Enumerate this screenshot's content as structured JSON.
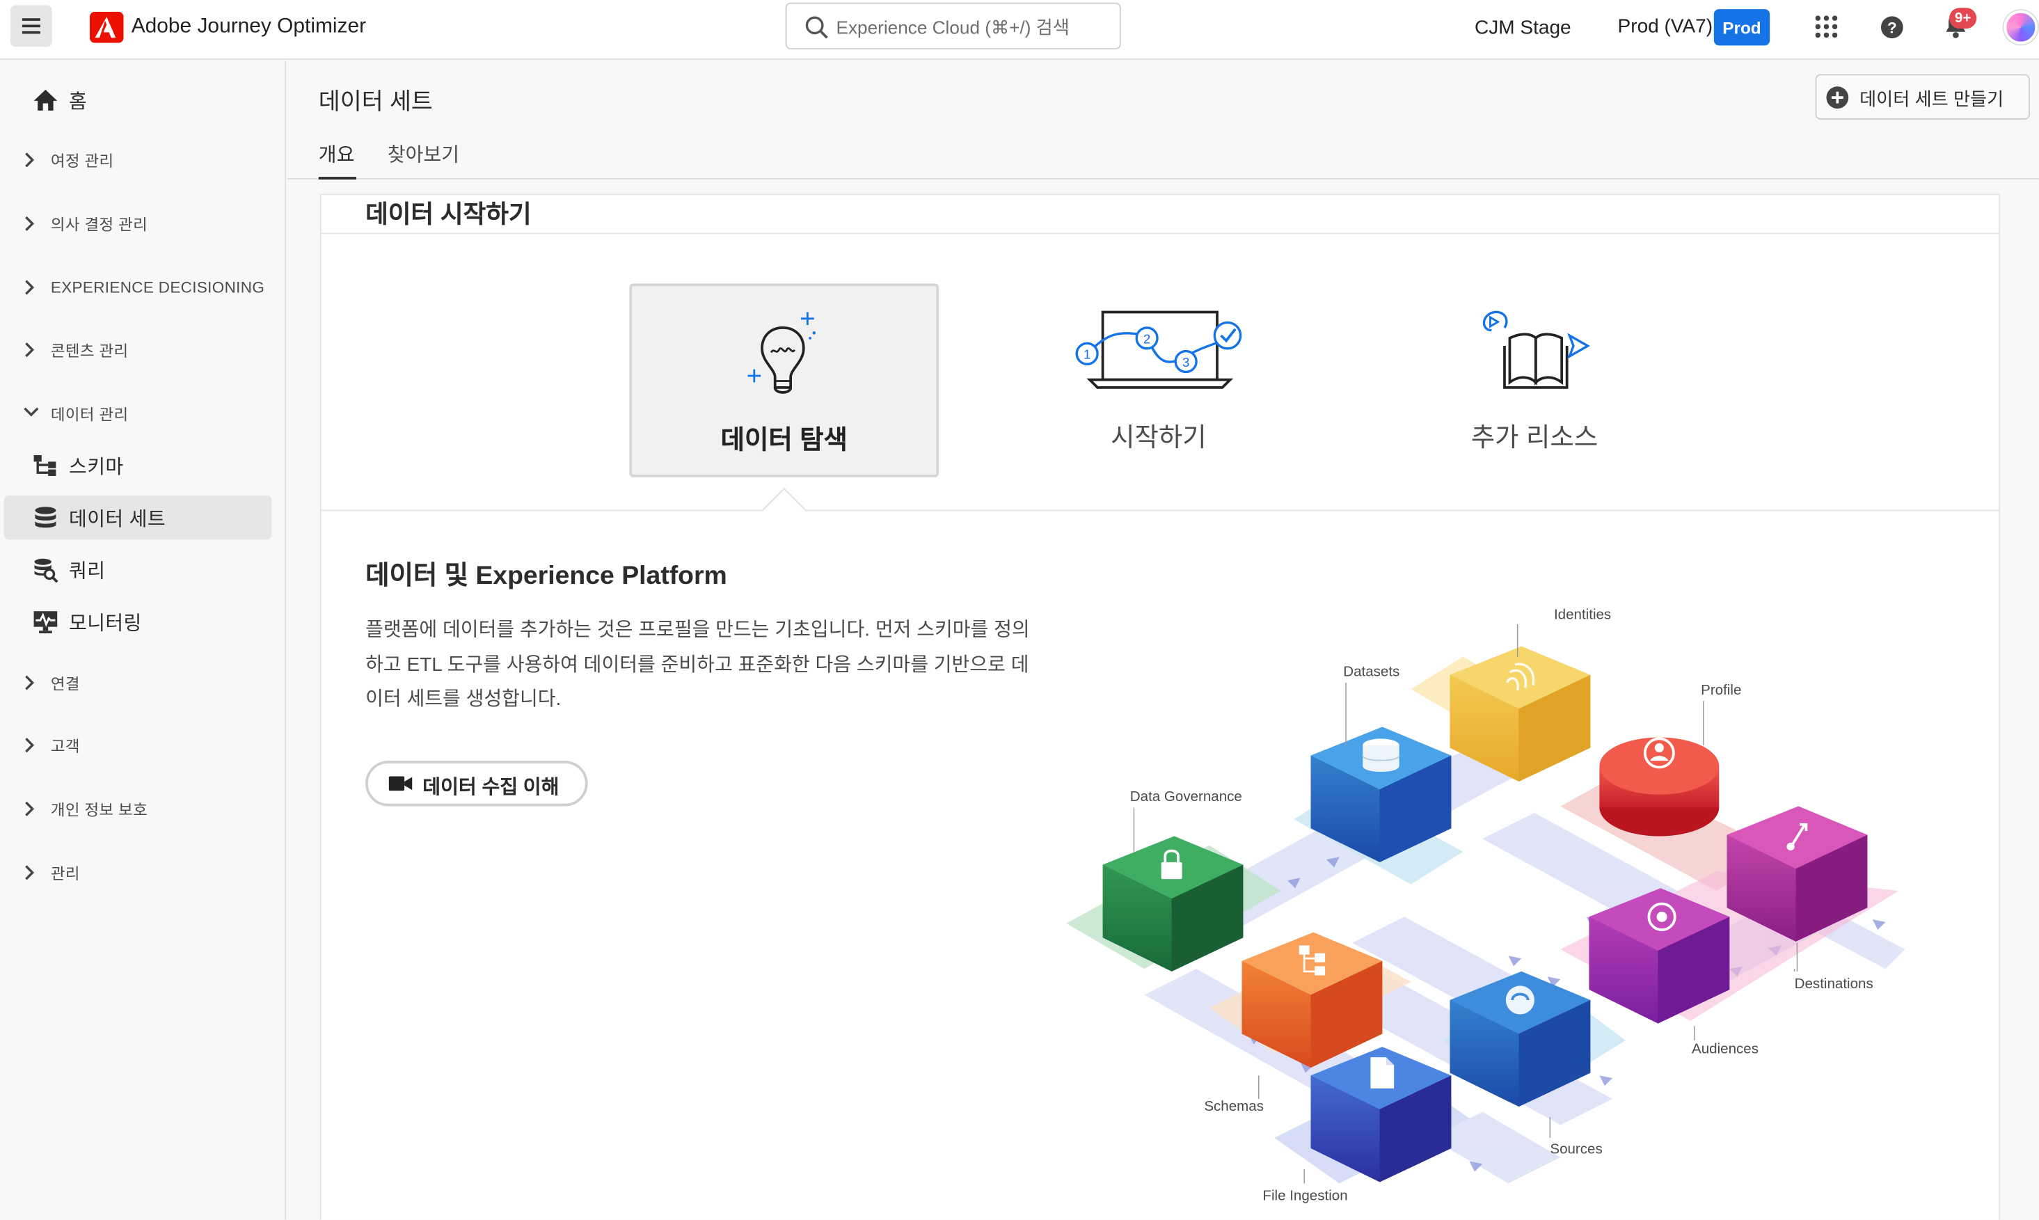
{
  "header": {
    "app_name": "Adobe Journey Optimizer",
    "search_placeholder": "Experience Cloud (⌘+/) 검색",
    "org": "CJM Stage",
    "sandbox": "Prod (VA7)",
    "sandbox_badge": "Prod",
    "notification_count": "9+",
    "accent_color": "#1473e6",
    "icons": [
      "menu-icon",
      "adobe-logo",
      "search-icon",
      "apps-grid-icon",
      "help-icon",
      "bell-icon",
      "avatar"
    ]
  },
  "sidebar": {
    "home": "홈",
    "items": [
      {
        "label": "여정 관리"
      },
      {
        "label": "의사 결정 관리"
      },
      {
        "label": "EXPERIENCE DECISIONING"
      },
      {
        "label": "콘텐츠 관리"
      },
      {
        "label": "데이터 관리"
      },
      {
        "label": "연결"
      },
      {
        "label": "고객"
      },
      {
        "label": "개인 정보 보호"
      },
      {
        "label": "관리"
      }
    ],
    "data_subitems": [
      {
        "label": "스키마",
        "icon": "schema-icon"
      },
      {
        "label": "데이터 세트",
        "icon": "database-icon",
        "selected": true
      },
      {
        "label": "쿼리",
        "icon": "query-icon"
      },
      {
        "label": "모니터링",
        "icon": "monitoring-icon"
      }
    ]
  },
  "page": {
    "title": "데이터 세트",
    "create_button": "데이터 세트 만들기",
    "tabs": [
      {
        "label": "개요",
        "active": true
      },
      {
        "label": "찾아보기"
      }
    ]
  },
  "card": {
    "title": "데이터 시작하기",
    "options": [
      {
        "label": "데이터 탐색",
        "selected": true,
        "icon": "lightbulb-icon"
      },
      {
        "label": "시작하기",
        "icon": "laptop-steps-icon"
      },
      {
        "label": "추가 리소스",
        "icon": "book-icon"
      }
    ],
    "section_title": "데이터 및 Experience Platform",
    "section_body": "플랫폼에 데이터를 추가하는 것은 프로필을 만드는 기초입니다. 먼저 스키마를 정의하고 ETL 도구를 사용하여 데이터를 준비하고 표준화한 다음 스키마를 기반으로 데이터 세트를 생성합니다.",
    "video_button": "데이터 수집 이해"
  },
  "illustration": {
    "labels": {
      "identities": "Identities",
      "datasets": "Datasets",
      "profile": "Profile",
      "data_governance": "Data Governance",
      "destinations": "Destinations",
      "audiences": "Audiences",
      "schemas": "Schemas",
      "sources": "Sources",
      "file_ingestion": "File Ingestion"
    }
  }
}
